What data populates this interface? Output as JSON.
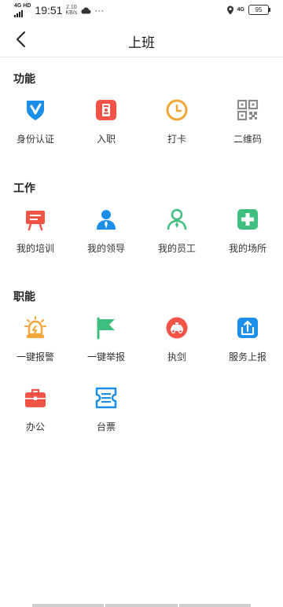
{
  "status": {
    "network": "4G HD",
    "time": "19:51",
    "speed_value": "2.10",
    "speed_unit": "KB/s",
    "more": "···",
    "lte": "4G",
    "battery": "95"
  },
  "header": {
    "title": "上班"
  },
  "sections": [
    {
      "title": "功能",
      "items": [
        "身份认证",
        "入职",
        "打卡",
        "二维码"
      ]
    },
    {
      "title": "工作",
      "items": [
        "我的培训",
        "我的领导",
        "我的员工",
        "我的场所"
      ]
    },
    {
      "title": "职能",
      "items": [
        "一键报警",
        "一键举报",
        "执剑",
        "服务上报",
        "办公",
        "台票"
      ]
    }
  ],
  "colors": {
    "blue": "#1a8ee8",
    "red": "#f15346",
    "orange": "#f2a63a",
    "gray": "#8a8a8a",
    "green": "#3fbf7f"
  }
}
